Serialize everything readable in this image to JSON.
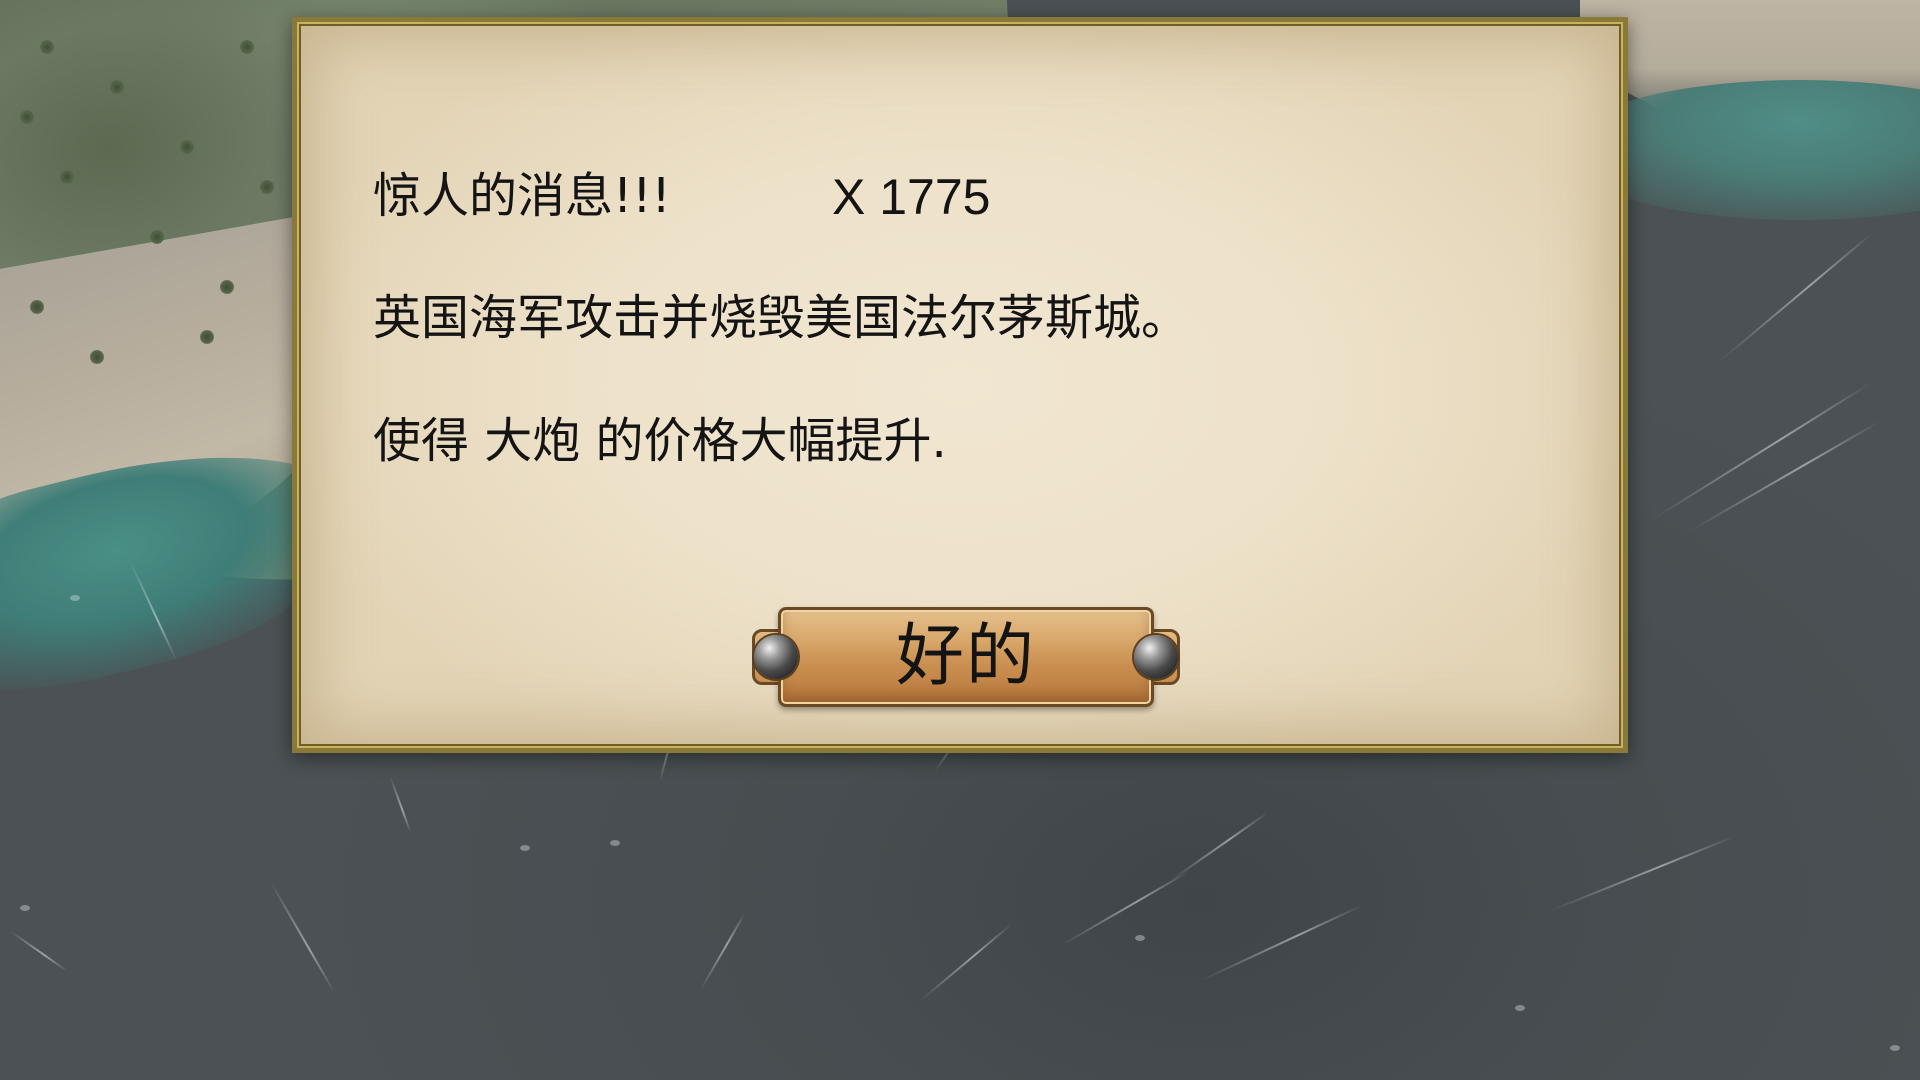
{
  "dialog": {
    "headline": "惊人的消息!!!",
    "year": "X 1775",
    "event": "英国海军攻击并烧毁美国法尔茅斯城。",
    "effect": "使得 大炮 的价格大幅提升."
  },
  "ok_button": {
    "label": "好的"
  },
  "colors": {
    "parchment": "#ede1c9",
    "frame_gold": "#8a7a3a",
    "button_wood": "#d9a96c",
    "sea": "#474d50",
    "text": "#141414"
  }
}
